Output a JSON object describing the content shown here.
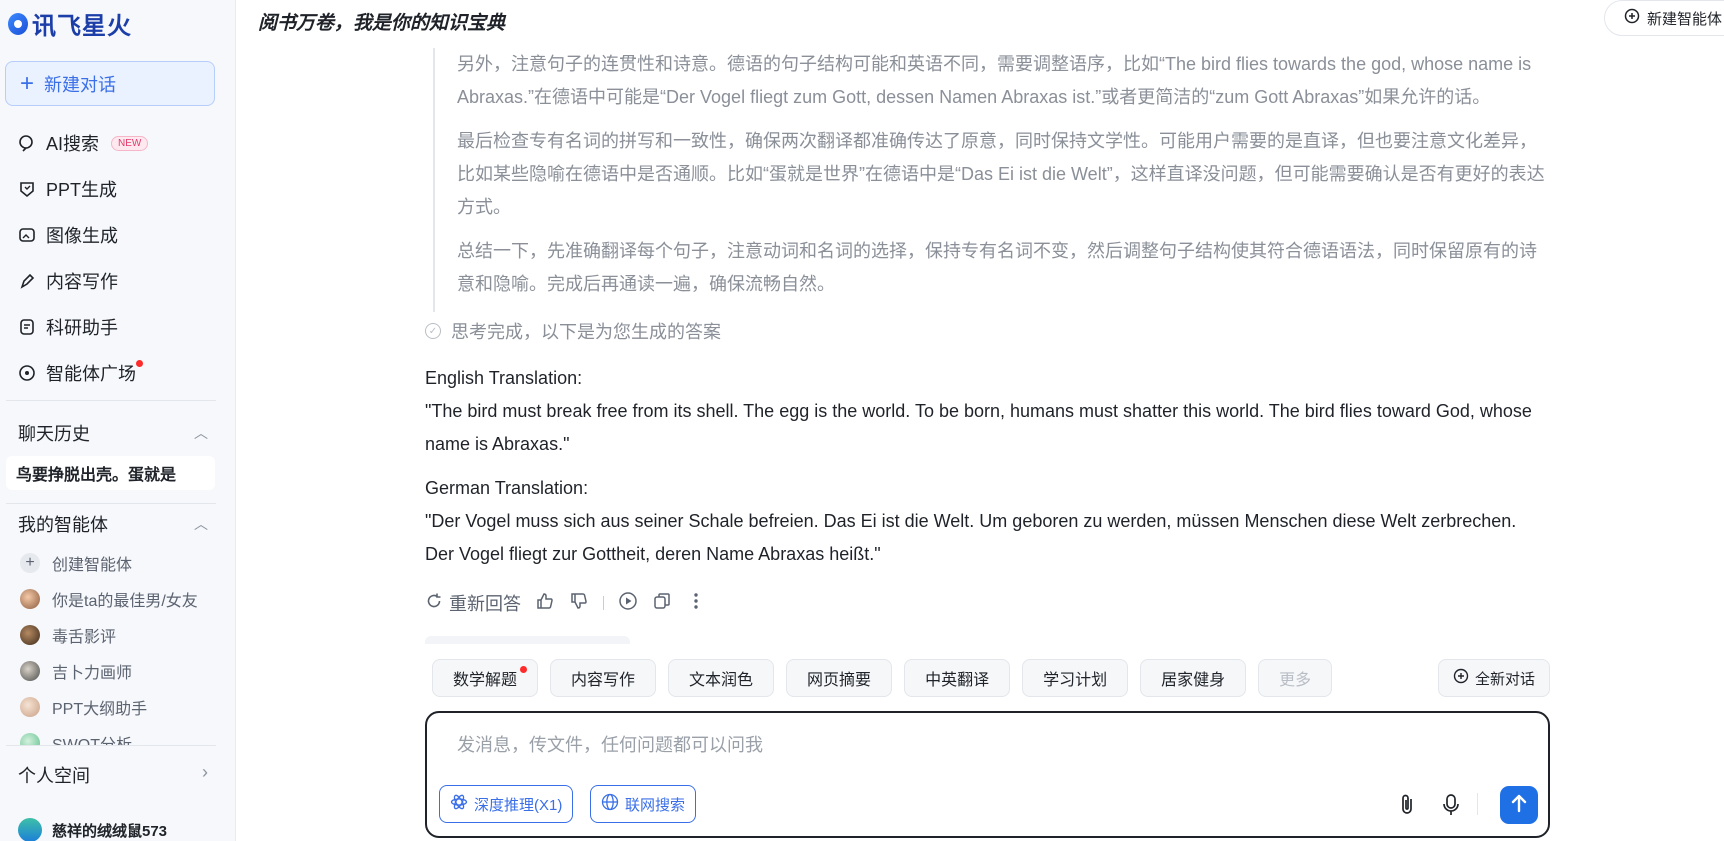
{
  "app": {
    "brand": "讯飞星火",
    "accent": "#3a6fe8"
  },
  "sidebar": {
    "new_chat": "新建对话",
    "nav": [
      {
        "label": "AI搜索",
        "badge": "NEW",
        "icon": "search-icon"
      },
      {
        "label": "PPT生成",
        "icon": "ppt-icon"
      },
      {
        "label": "图像生成",
        "icon": "image-icon"
      },
      {
        "label": "内容写作",
        "icon": "pen-icon"
      },
      {
        "label": "科研助手",
        "icon": "research-icon"
      },
      {
        "label": "智能体广场",
        "icon": "agent-square-icon",
        "dot": true
      }
    ],
    "history_title": "聊天历史",
    "history_items": [
      "鸟要挣脱出壳。蛋就是"
    ],
    "agents_title": "我的智能体",
    "agents": [
      "创建智能体",
      "你是ta的最佳男/女友",
      "毒舌影评",
      "吉卜力画师",
      "PPT大纲助手",
      "SWOT分析"
    ],
    "personal": "个人空间",
    "user": "慈祥的绒绒鼠573"
  },
  "header": {
    "title": "阅书万卷，我是你的知识宝典",
    "new_agent": "新建智能体"
  },
  "thinking": {
    "paragraphs": [
      "另外，注意句子的连贯性和诗意。德语的句子结构可能和英语不同，需要调整语序，比如“The bird flies towards the god, whose name is Abraxas.”在德语中可能是“Der Vogel fliegt zum Gott, dessen Namen Abraxas ist.”或者更简洁的“zum Gott Abraxas”如果允许的话。",
      "最后检查专有名词的拼写和一致性，确保两次翻译都准确传达了原意，同时保持文学性。可能用户需要的是直译，但也要注意文化差异，比如某些隐喻在德语中是否通顺。比如“蛋就是世界”在德语中是“Das Ei ist die Welt”，这样直译没问题，但可能需要确认是否有更好的表达方式。",
      "总结一下，先准确翻译每个句子，注意动词和名词的选择，保持专有名词不变，然后调整句子结构使其符合德语语法，同时保留原有的诗意和隐喻。完成后再通读一遍，确保流畅自然。"
    ],
    "done": "思考完成，以下是为您生成的答案"
  },
  "answer": {
    "en_label": "English Translation:",
    "en_text": "\"The bird must break free from its shell. The egg is the world. To be born, humans must shatter this world. The bird flies toward God, whose name is Abraxas.\"",
    "de_label": "German Translation:",
    "de_text": "\"Der Vogel muss sich aus seiner Schale befreien. Das Ei ist die Welt. Um geboren zu werden, müssen Menschen diese Welt zerbrechen. Der Vogel fliegt zur Gottheit, deren Name Abraxas heißt.\""
  },
  "actions": {
    "regenerate": "重新回答"
  },
  "chips": [
    "数学解题",
    "内容写作",
    "文本润色",
    "网页摘要",
    "中英翻译",
    "学习计划",
    "居家健身",
    "更多"
  ],
  "new_conversation": "全新对话",
  "input": {
    "placeholder": "发消息，传文件，任何问题都可以问我",
    "deep_reasoning": "深度推理(X1)",
    "web_search": "联网搜索"
  }
}
